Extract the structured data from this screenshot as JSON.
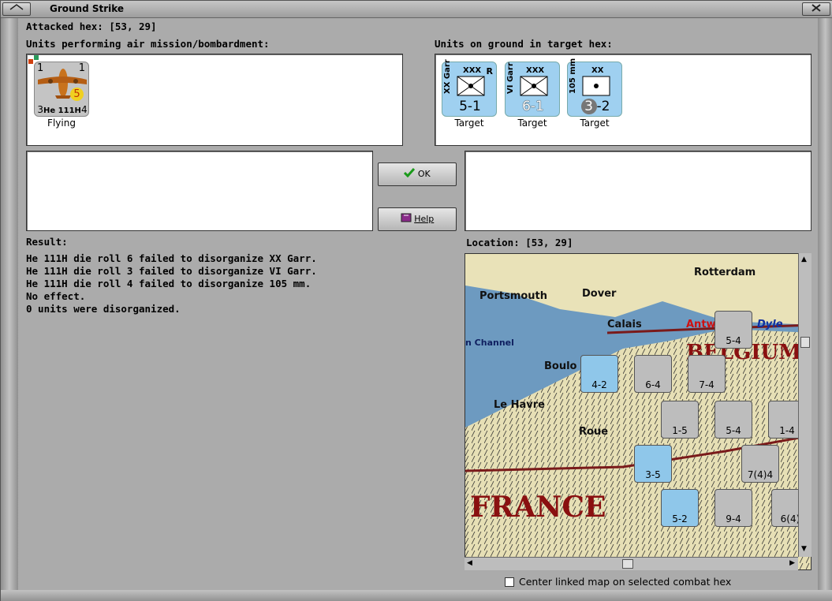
{
  "window": {
    "title": "Ground Strike"
  },
  "header": {
    "attacked_hex_label": "Attacked hex:",
    "attacked_hex_value": "[53, 29]"
  },
  "air_panel": {
    "label": "Units performing air mission/bombardment:",
    "units": [
      {
        "name": "He 111H",
        "left": "3",
        "right": "4",
        "top_left": "1",
        "top_right": "1",
        "badge": "5",
        "status": "Flying"
      }
    ]
  },
  "ground_panel": {
    "label": "Units on ground in target hex:",
    "units": [
      {
        "side": "XX Garr",
        "size": "XXX",
        "flag": "R",
        "strength": "5-1",
        "status": "Target"
      },
      {
        "side": "VI Garr",
        "size": "XXX",
        "flag": "",
        "strength": "6-1",
        "status": "Target"
      },
      {
        "side": "105 mm",
        "size": "XX",
        "flag": "",
        "strength_a": "3",
        "strength_b": "2",
        "status": "Target"
      }
    ]
  },
  "buttons": {
    "ok": "OK",
    "help": "Help"
  },
  "result": {
    "label": "Result:",
    "lines": [
      "He 111H die roll 6 failed to disorganize XX Garr.",
      "He 111H die roll 3 failed to disorganize VI Garr.",
      "He 111H die roll 4 failed to disorganize 105 mm.",
      "No effect.",
      "0 units were disorganized."
    ]
  },
  "location": {
    "label": "Location:",
    "value": "[53, 29]"
  },
  "map": {
    "places": [
      "Rotterdam",
      "Portsmouth",
      "Dover",
      "Calais",
      "Antw",
      "Dyle",
      "n Channel",
      "Boulo",
      "Le Havre",
      "Roue",
      "FRANCE",
      "BELGIUM"
    ],
    "counters": [
      "5-4",
      "4-2",
      "6-4",
      "7-4",
      "1-5",
      "5-4",
      "1-4",
      "3-5",
      "7(4)4",
      "5-2",
      "9-4",
      "6(4)"
    ]
  },
  "checkbox": {
    "label": "Center linked map on selected combat hex",
    "checked": false
  },
  "colors": {
    "ground_unit": "#9fd0f0",
    "air_unit": "#c4c4c4",
    "ok_check": "#1a9a1a"
  }
}
